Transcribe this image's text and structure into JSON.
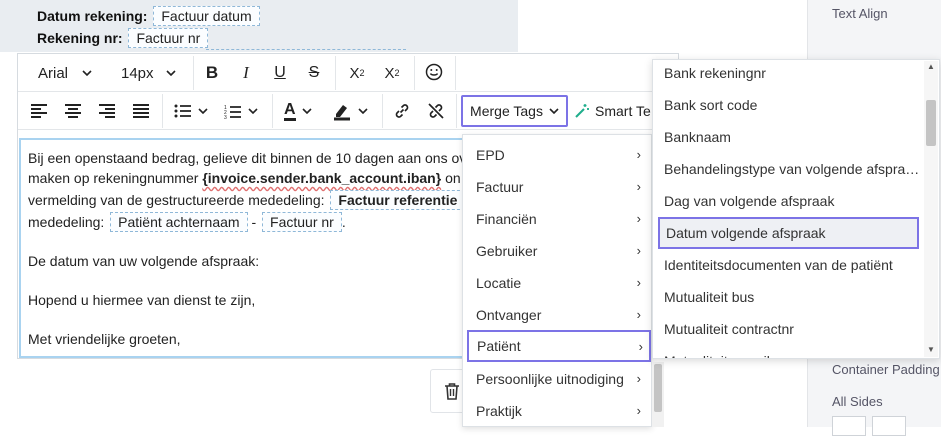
{
  "preview": {
    "datum_label": "Datum rekening:",
    "datum_value": "Factuur datum",
    "rekening_label": "Rekening nr:",
    "rekening_value": "Factuur nr"
  },
  "right_panel": {
    "text_align": "Text Align",
    "container_padding": "Container Padding",
    "all_sides": "All Sides"
  },
  "toolbar": {
    "font_family": "Arial",
    "font_size": "14px",
    "merge_tags_label": "Merge Tags",
    "smart_text_label": "Smart Te"
  },
  "content": {
    "line1": "Bij een openstaand bedrag, gelieve dit binnen de 10 dagen aan ons ov",
    "line2_a": "maken op rekeningnummer ",
    "line2_tag": "{invoice.sender.bank_account.iban}",
    "line2_b": " on",
    "line3_a": "vermelding van de gestructureerde mededeling: ",
    "line3_chip": "Factuur referentie",
    "line4_a": "mededeling: ",
    "line4_chip1": "Patiënt achternaam",
    "line4_dash": " - ",
    "line4_chip2": "Factuur nr",
    "line4_end": ".",
    "line5": "De datum van uw volgende afspraak:",
    "line6": "Hopend u hiermee van dienst te zijn,",
    "line7": "Met vriendelijke groeten,"
  },
  "merge_menu": {
    "items": [
      {
        "label": "EPD"
      },
      {
        "label": "Factuur"
      },
      {
        "label": "Financiën"
      },
      {
        "label": "Gebruiker"
      },
      {
        "label": "Locatie"
      },
      {
        "label": "Ontvanger"
      },
      {
        "label": "Patiënt"
      },
      {
        "label": "Persoonlijke uitnodiging"
      },
      {
        "label": "Praktijk"
      }
    ],
    "chevron": "›"
  },
  "sub_menu": {
    "items": [
      {
        "label": "Bank rekeningnr"
      },
      {
        "label": "Bank sort code"
      },
      {
        "label": "Banknaam"
      },
      {
        "label": "Behandelingstype van volgende afspra…"
      },
      {
        "label": "Dag van volgende afspraak"
      },
      {
        "label": "Datum volgende afspraak"
      },
      {
        "label": "Identiteitsdocumenten van de patiënt"
      },
      {
        "label": "Mutualiteit bus"
      },
      {
        "label": "Mutualiteit contractnr"
      },
      {
        "label": "Mutualiteit e-mail"
      }
    ]
  },
  "colors": {
    "accent": "#7c73e6",
    "editor_border": "#a9d3f0",
    "highlight_bg": "#eef0f4"
  }
}
